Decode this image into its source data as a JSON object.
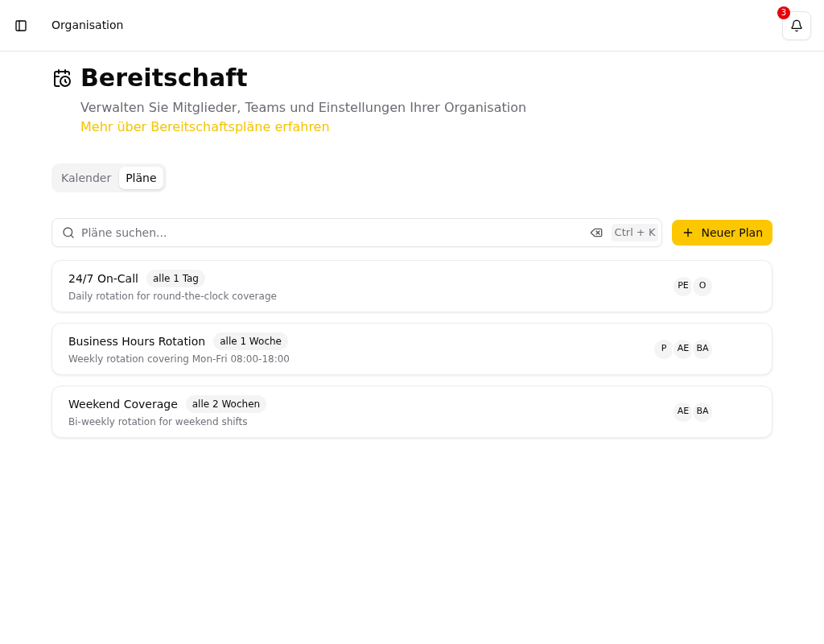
{
  "header": {
    "title": "Organisation",
    "notifications": {
      "count": "3"
    }
  },
  "page": {
    "title": "Bereitschaft",
    "description": "Verwalten Sie Mitglieder, Teams und Einstellungen Ihrer Organisation",
    "link": "Mehr über Bereitschaftspläne erfahren"
  },
  "tabs": [
    {
      "label": "Kalender",
      "selected": false
    },
    {
      "label": "Pläne",
      "selected": true
    }
  ],
  "search": {
    "placeholder": "Pläne suchen...",
    "shortcut": "Ctrl + K"
  },
  "new_button": {
    "label": "Neuer Plan"
  },
  "plans": [
    {
      "name": "24/7 On-Call",
      "interval": "alle 1 Tag",
      "description": "Daily rotation for round-the-clock coverage",
      "members": [
        "PE",
        "O"
      ]
    },
    {
      "name": "Business Hours Rotation",
      "interval": "alle 1 Woche",
      "description": "Weekly rotation covering Mon-Fri 08:00-18:00",
      "members": [
        "P",
        "AE",
        "BA"
      ]
    },
    {
      "name": "Weekend Coverage",
      "interval": "alle 2 Wochen",
      "description": "Bi-weekly rotation for weekend shifts",
      "members": [
        "AE",
        "BA"
      ]
    }
  ]
}
